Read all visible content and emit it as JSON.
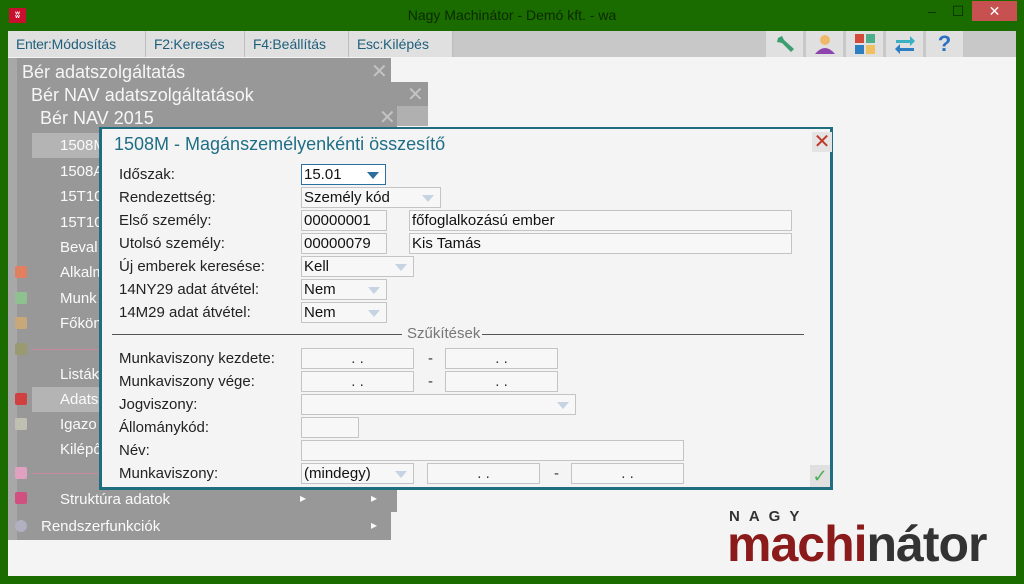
{
  "window": {
    "title": "Nagy Machinátor - Demó kft. - wa",
    "app_icon": "app-logo-icon",
    "minimize": "–",
    "maximize": "☐",
    "close": "✕"
  },
  "toolbar": {
    "items": [
      {
        "key": "Enter:",
        "label": "Módosítás"
      },
      {
        "key": "F2:",
        "label": "Keresés"
      },
      {
        "key": "F4:",
        "label": "Beállítás"
      },
      {
        "key": "Esc:",
        "label": "Kilépés"
      }
    ],
    "icons": [
      "wrench-icon",
      "user-icon",
      "tiles-icon",
      "transfer-arrows-icon",
      "help-icon"
    ],
    "help_glyph": "?"
  },
  "menus": {
    "level1": {
      "title": "Bér adatszolgáltatás"
    },
    "level2": {
      "title": "Bér NAV adatszolgáltatások"
    },
    "level3": {
      "title": "Bér NAV 2015"
    },
    "close": "✕",
    "items": [
      "1508M",
      "1508A",
      "15T10",
      "15T10",
      "Beval",
      "Alkalm",
      "Munk",
      "Főkön",
      "Listák",
      "Adats",
      "Igazo",
      "Kilépő",
      "Struktúra adatok"
    ],
    "bottom": "Rendszerfunkciók",
    "arrow": "▸"
  },
  "dialog": {
    "title": "1508M - Magánszemélyenkénti összesítő",
    "close": "✕",
    "ok": "✓",
    "fields": {
      "idoszak": {
        "label": "Időszak:",
        "value": "15.01"
      },
      "rendezettseg": {
        "label": "Rendezettség:",
        "value": "Személy kód"
      },
      "elso": {
        "label": "Első személy:",
        "code": "00000001",
        "name": "főfoglalkozású ember"
      },
      "utolso": {
        "label": "Utolsó személy:",
        "code": "00000079",
        "name": "Kis Tamás"
      },
      "uj": {
        "label": "Új emberek keresése:",
        "value": "Kell"
      },
      "ny29": {
        "label": "14NY29 adat átvétel:",
        "value": "Nem"
      },
      "m29": {
        "label": "14M29 adat átvétel:",
        "value": "Nem"
      }
    },
    "section": "Szűkítések",
    "filters": {
      "kezdete": {
        "label": "Munkaviszony kezdete:",
        "from": ". .",
        "to": ". ."
      },
      "vege": {
        "label": "Munkaviszony vége:",
        "from": ". .",
        "to": ". ."
      },
      "jogviszony": {
        "label": "Jogviszony:",
        "value": ""
      },
      "allomany": {
        "label": "Állománykód:",
        "value": ""
      },
      "nev": {
        "label": "Név:",
        "value": ""
      },
      "munkaviszony": {
        "label": "Munkaviszony:",
        "value": "(mindegy)",
        "from": ". .",
        "to": ". ."
      },
      "dash": "-"
    }
  },
  "logo": {
    "top": "NAGY",
    "part1": "machi",
    "part2": "nátor"
  },
  "colors": {
    "frame": "#1a6b00",
    "accent": "#1e6e80",
    "menu": "#989898",
    "logo_red": "#8b1a1a"
  }
}
